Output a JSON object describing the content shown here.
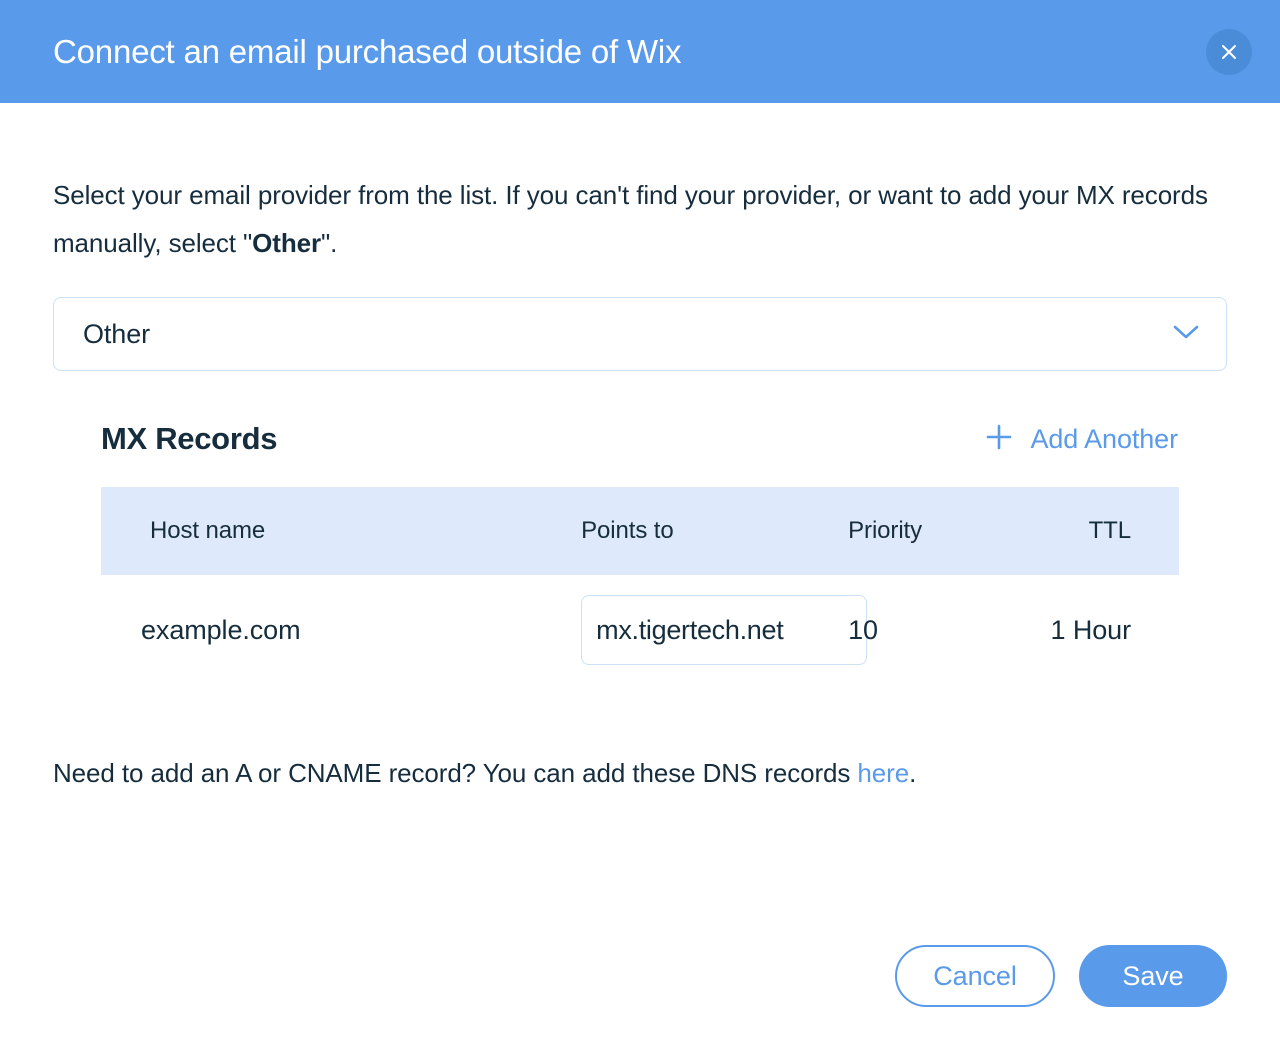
{
  "header": {
    "title": "Connect an email purchased outside of Wix",
    "close_icon": "close-icon",
    "background_color": "#5a9aea",
    "close_button_color": "#4b8cd8"
  },
  "intro": {
    "text_before": "Select your email provider from the list. If you can't find your provider, or want to add your MX records manually, select \"",
    "emphasis": "Other",
    "text_after": "\"."
  },
  "provider_select": {
    "value": "Other",
    "chevron_icon": "chevron-down-icon",
    "accent_color": "#5a9aea",
    "border_color": "#cce0f6"
  },
  "records": {
    "title": "MX Records",
    "add_another_label": "Add Another",
    "add_icon": "plus-icon",
    "columns": [
      "Host name",
      "Points to",
      "Priority",
      "TTL"
    ],
    "rows": [
      {
        "host_name": "example.com",
        "points_to": "mx.tigertech.net",
        "priority": "10",
        "ttl": "1 Hour"
      }
    ],
    "header_background": "#deeafb"
  },
  "footnote": {
    "text_before": "Need to add an A or CNAME record? You can add these DNS records ",
    "link_text": "here",
    "text_after": "."
  },
  "footer": {
    "cancel_label": "Cancel",
    "save_label": "Save"
  }
}
